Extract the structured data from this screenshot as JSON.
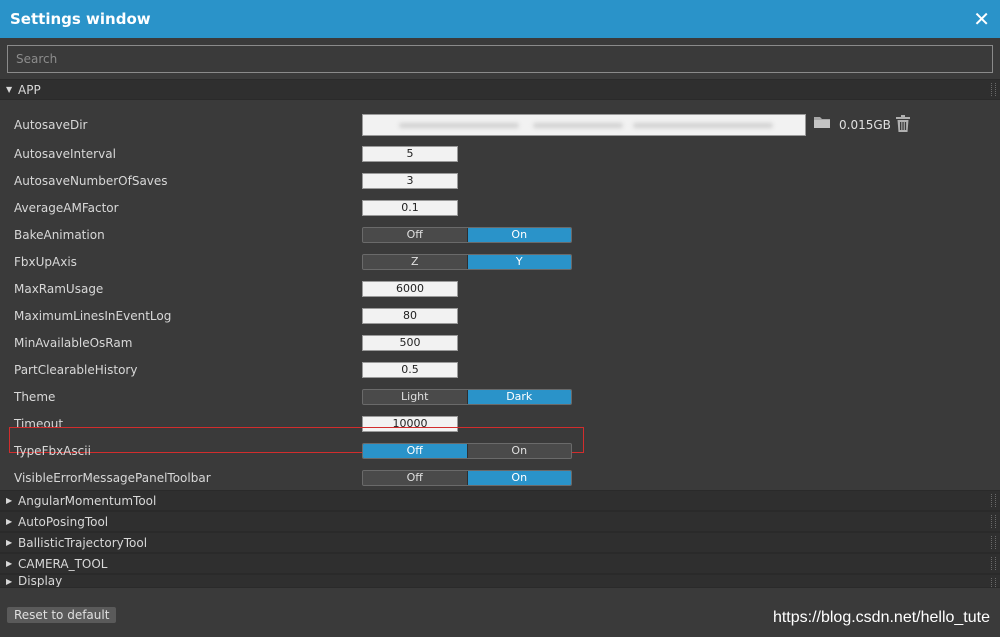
{
  "window": {
    "title": "Settings window",
    "close_glyph": "✕"
  },
  "search": {
    "placeholder": "Search",
    "value": ""
  },
  "sections": {
    "app": {
      "label": "APP",
      "expanded": true
    },
    "collapsed": [
      {
        "label": "AngularMomentumTool"
      },
      {
        "label": "AutoPosingTool"
      },
      {
        "label": "BallisticTrajectoryTool"
      },
      {
        "label": "CAMERA_TOOL"
      },
      {
        "label": "Display"
      }
    ]
  },
  "settings": {
    "autosave_dir": {
      "label": "AutosaveDir",
      "size": "0.015GB"
    },
    "autosave_interval": {
      "label": "AutosaveInterval",
      "value": "5"
    },
    "autosave_number": {
      "label": "AutosaveNumberOfSaves",
      "value": "3"
    },
    "average_am": {
      "label": "AverageAMFactor",
      "value": "0.1"
    },
    "bake_animation": {
      "label": "BakeAnimation",
      "options": [
        "Off",
        "On"
      ],
      "selected": "On"
    },
    "fbx_up_axis": {
      "label": "FbxUpAxis",
      "options": [
        "Z",
        "Y"
      ],
      "selected": "Y"
    },
    "max_ram": {
      "label": "MaxRamUsage",
      "value": "6000"
    },
    "max_lines": {
      "label": "MaximumLinesInEventLog",
      "value": "80"
    },
    "min_os_ram": {
      "label": "MinAvailableOsRam",
      "value": "500"
    },
    "part_clearable": {
      "label": "PartClearableHistory",
      "value": "0.5"
    },
    "theme": {
      "label": "Theme",
      "options": [
        "Light",
        "Dark"
      ],
      "selected": "Dark"
    },
    "timeout": {
      "label": "Timeout",
      "value": "10000"
    },
    "type_fbx_ascii": {
      "label": "TypeFbxAscii",
      "options": [
        "Off",
        "On"
      ],
      "selected": "Off"
    },
    "visible_error": {
      "label": "VisibleErrorMessagePanelToolbar",
      "options": [
        "Off",
        "On"
      ],
      "selected": "On"
    }
  },
  "footer": {
    "reset_label": "Reset to default",
    "watermark": "https://blog.csdn.net/hello_tute"
  },
  "colors": {
    "accent": "#2a93c9",
    "highlight_border": "#d22d2d",
    "background": "#3a3a3a"
  },
  "icons": {
    "folder": "folder-icon",
    "trash": "trash-icon",
    "close": "close-icon"
  }
}
